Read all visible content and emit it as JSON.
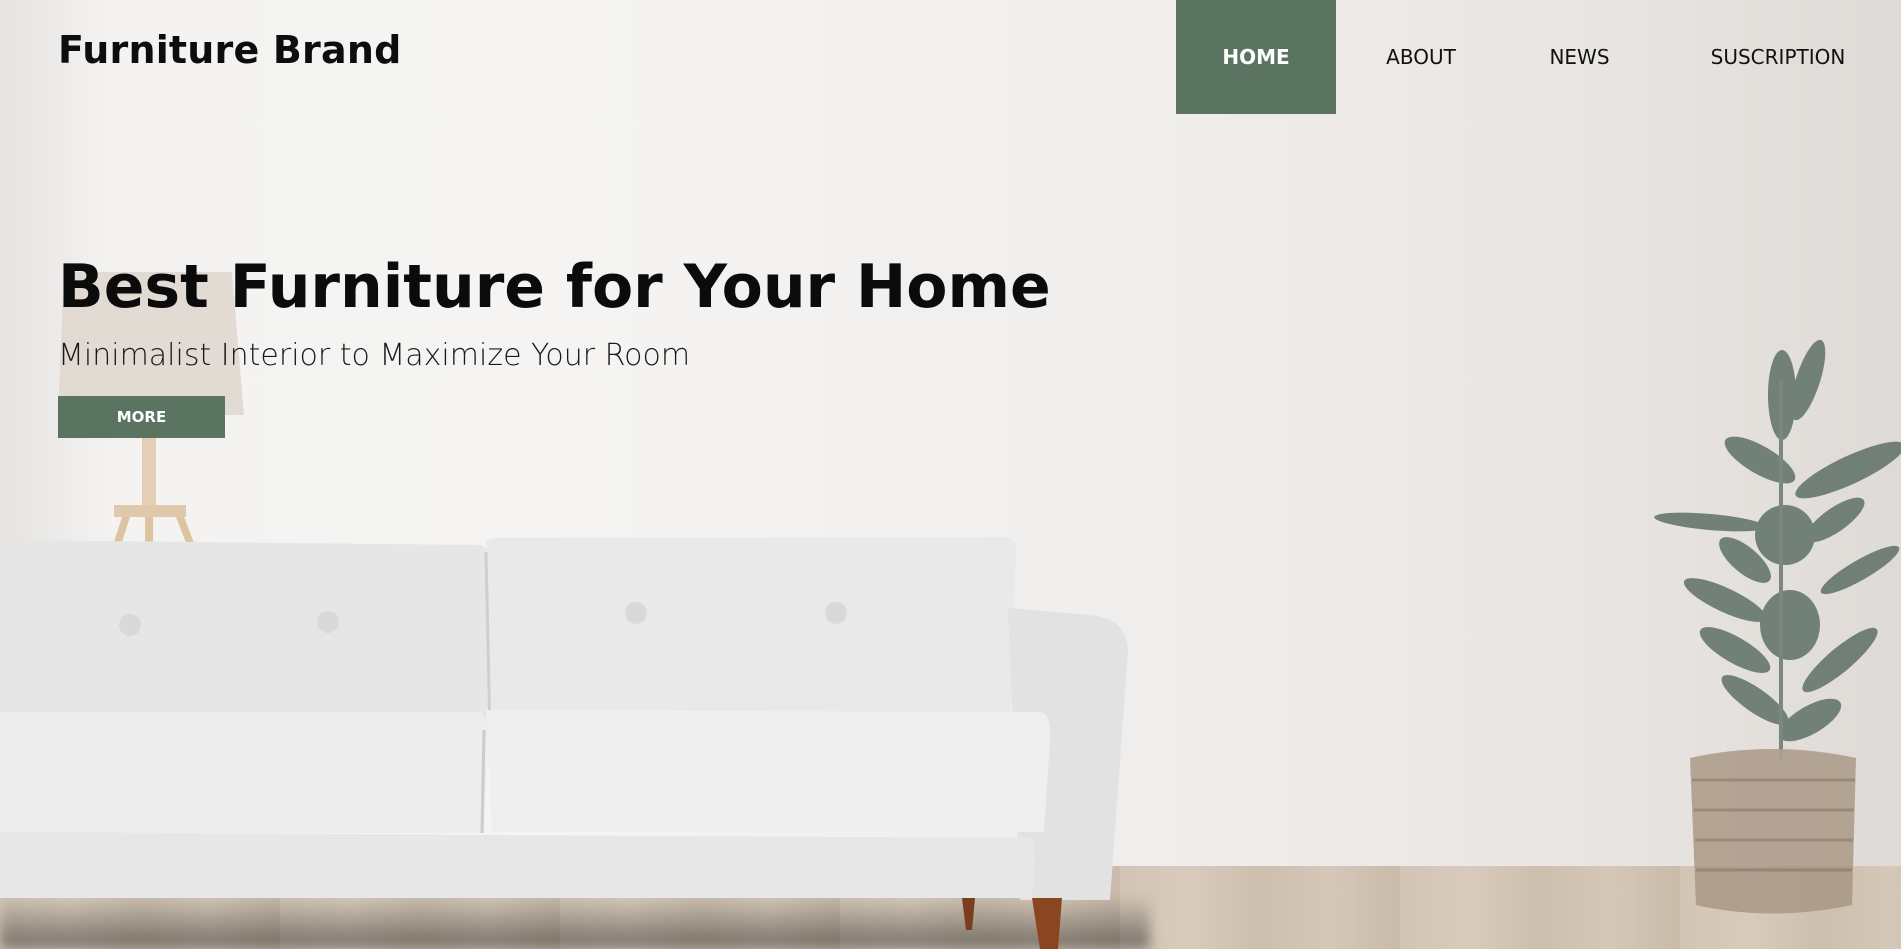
{
  "header": {
    "brand": "Furniture Brand"
  },
  "nav": {
    "items": [
      {
        "label": "HOME",
        "active": true
      },
      {
        "label": "ABOUT",
        "active": false
      },
      {
        "label": "NEWS",
        "active": false
      },
      {
        "label": "SUSCRIPTION",
        "active": false
      }
    ]
  },
  "hero": {
    "title": "Best Furniture for Your Home",
    "subtitle": "Minimalist Interior to Maximize Your Room",
    "cta_label": "MORE"
  },
  "colors": {
    "accent": "#5b7462",
    "text": "#0d0d0d",
    "background": "#f5f4f2"
  },
  "icons": [
    "sofa-illustration",
    "table-lamp-illustration",
    "potted-plant-illustration"
  ]
}
